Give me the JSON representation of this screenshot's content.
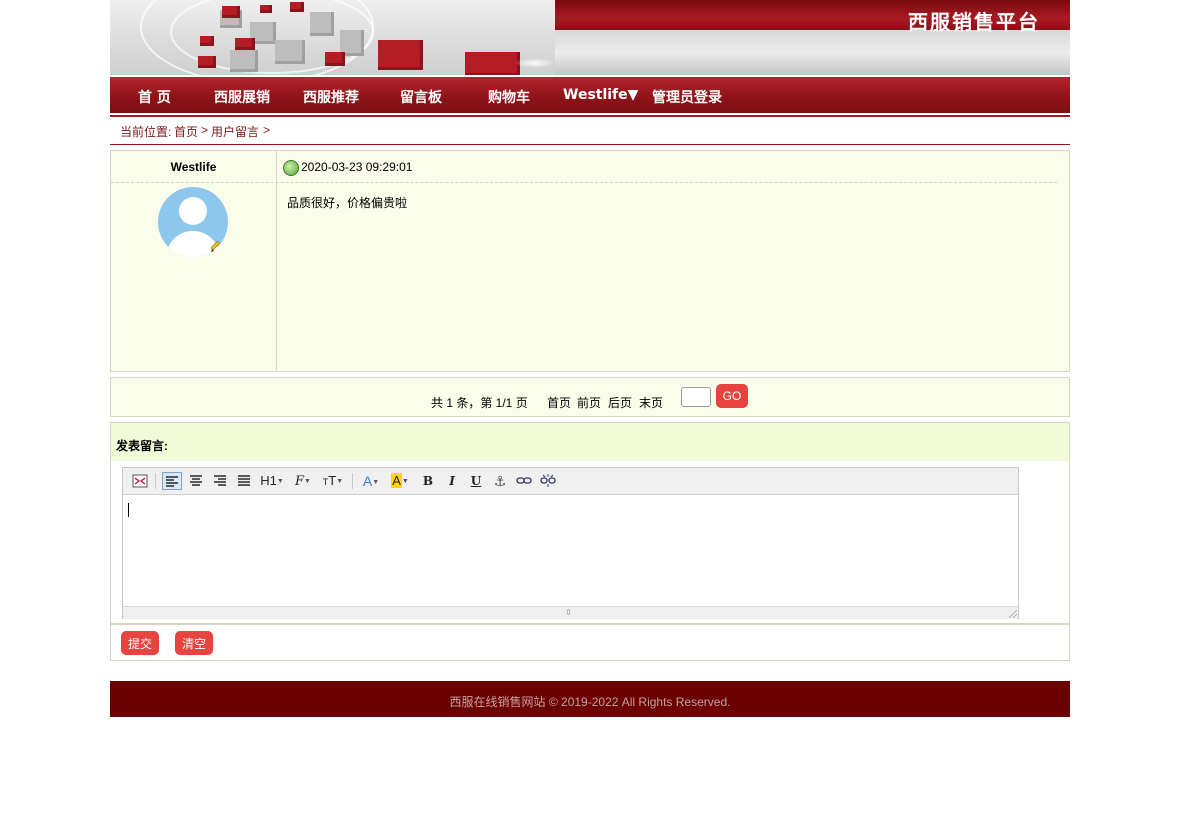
{
  "header": {
    "site_title": "西服销售平台"
  },
  "nav": {
    "items": [
      {
        "label": "首 页"
      },
      {
        "label": "西服展销"
      },
      {
        "label": "西服推荐"
      },
      {
        "label": "留言板"
      },
      {
        "label": "购物车"
      },
      {
        "label": "Westlife▼"
      },
      {
        "label": "管理员登录"
      }
    ]
  },
  "breadcrumb": {
    "prefix": "当前位置:",
    "home": "首页",
    "sep1": ">",
    "current": "用户留言",
    "sep2": ">"
  },
  "message": {
    "author": "Westlife",
    "datetime": "2020-03-23 09:29:01",
    "content": "品质很好，价格偏贵啦"
  },
  "pager": {
    "summary": "共 1 条，第 1/1 页",
    "first": "首页",
    "prev": "前页",
    "next": "后页",
    "last": "末页",
    "page_input_value": "",
    "go_label": "GO"
  },
  "post": {
    "heading": "发表留言:",
    "editor_content": ""
  },
  "toolbar": {
    "h1": "H1",
    "bold": "B",
    "italic": "I",
    "underline": "U"
  },
  "actions": {
    "submit_label": "提交",
    "clear_label": "清空"
  },
  "footer": {
    "text": "西服在线销售网站  © 2019-2022 All Rights Reserved."
  },
  "colors": {
    "brand_red": "#8f141a",
    "footer_bg": "#6a0000",
    "button_red": "#e8443f",
    "panel_bg": "#fbfdeb"
  }
}
